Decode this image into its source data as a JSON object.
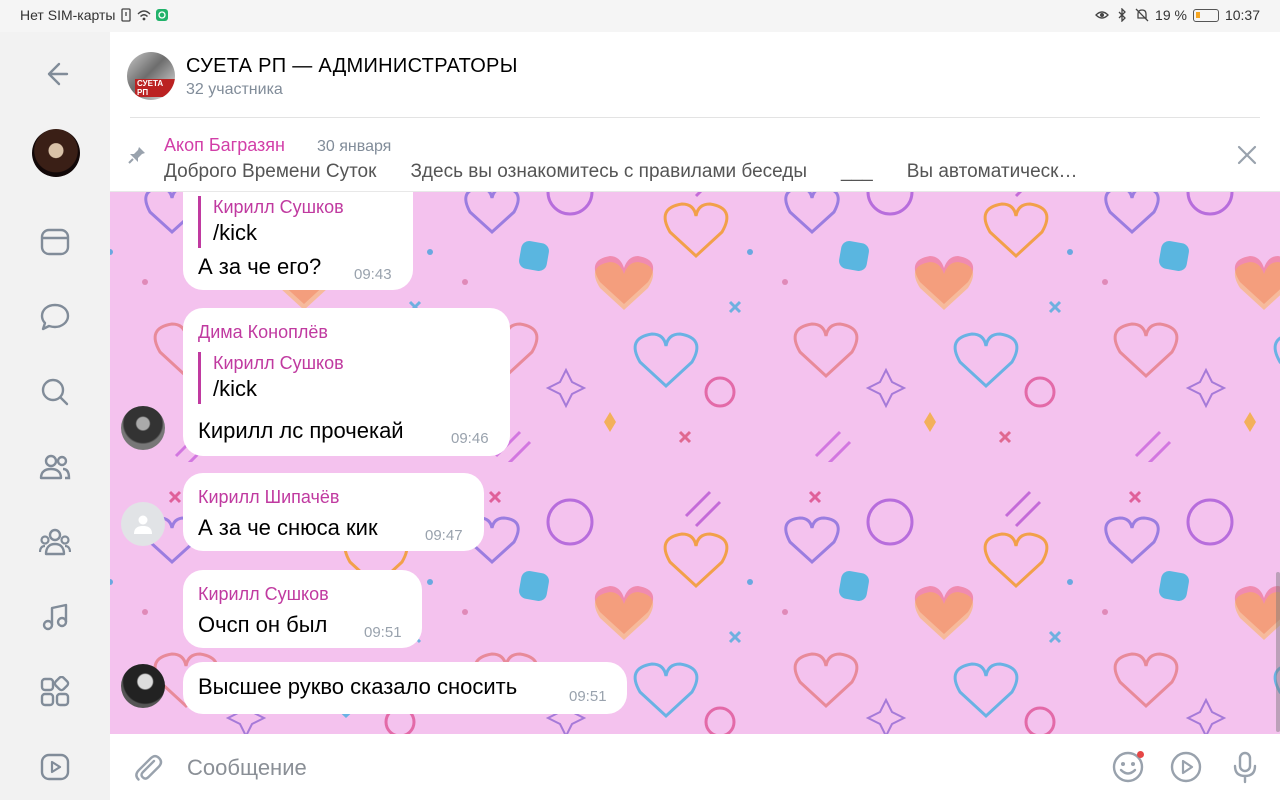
{
  "status_bar": {
    "carrier": "Нет SIM-карты",
    "battery": "19 %",
    "battery_level": 0.19,
    "time": "10:37"
  },
  "header": {
    "title": "СУЕТА РП — АДМИНИСТРАТОРЫ",
    "subtitle": "32 участника",
    "avatar_label": "СУЕТА РП"
  },
  "pinned": {
    "author": "Акоп Багразян",
    "date": "30 января",
    "text_parts": [
      "Доброго Времени Суток",
      "Здесь вы ознакомитесь с правилами беседы",
      "___",
      "Вы автоматическ…"
    ]
  },
  "messages": [
    {
      "reply_author": "Кирилл Сушков",
      "reply_text": "/kick",
      "text": "А за че его?",
      "time": "09:43"
    },
    {
      "author": "Дима Коноплёв",
      "reply_author": "Кирилл Сушков",
      "reply_text": "/kick",
      "text": "Кирилл лс прочекай",
      "time": "09:46"
    },
    {
      "author": "Кирилл Шипачёв",
      "text": "А за че снюса кик",
      "time": "09:47"
    },
    {
      "author": "Кирилл Сушков",
      "text": "Очсп он был",
      "time": "09:51"
    },
    {
      "text": "Высшее рукво сказало сносить",
      "time": "09:51"
    }
  ],
  "composer": {
    "placeholder": "Сообщение"
  },
  "icons": {
    "rail": [
      "back-arrow-icon",
      "profile-avatar",
      "news-icon",
      "messages-icon",
      "search-icon",
      "friends-icon",
      "communities-icon",
      "music-icon",
      "services-icon",
      "video-icon"
    ],
    "composer": [
      "attach-icon",
      "emoji-icon",
      "video-message-icon",
      "microphone-icon"
    ]
  },
  "colors": {
    "accent": "#c03aa0",
    "chat_background": "#f4c2ee",
    "icon_gray": "#99a2ad"
  }
}
